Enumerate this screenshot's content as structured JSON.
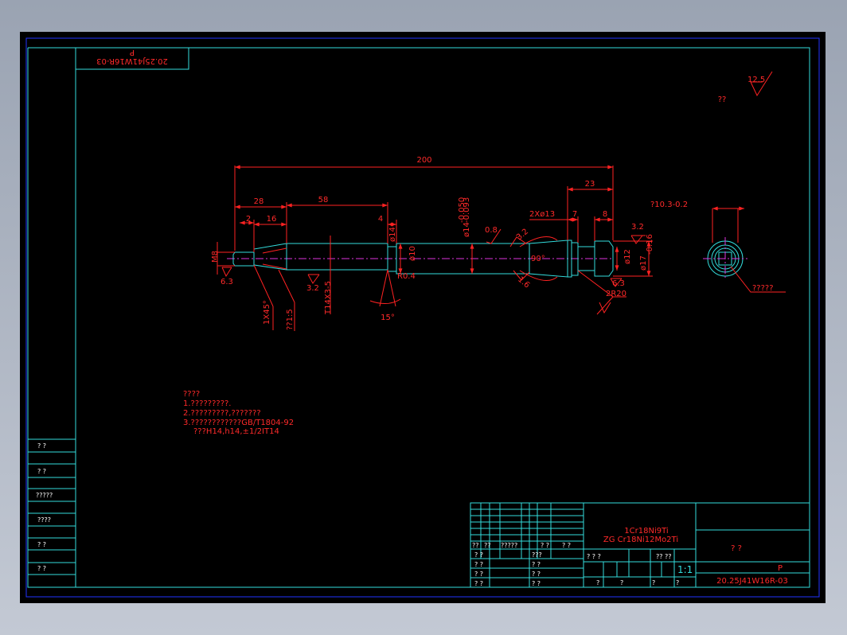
{
  "drawing_number": "20.25J41W16R-03",
  "drawing_number_rotated": "20.25J41W16R-03",
  "rev": "P",
  "rev_rotated": "P",
  "title_unknown": "? ?",
  "scale": "1:1",
  "material_line1": "1Cr18Ni9Ti",
  "material_line2": "ZG Cr18Ni12Mo2Ti",
  "roughness_general": "12.5",
  "roughness_general_label": "??",
  "dims": {
    "overall": "200",
    "d28": "28",
    "d58": "58",
    "d2": "2",
    "d16": "16",
    "d4": "4",
    "d23": "23",
    "d7": "7",
    "d8": "8",
    "hole": "2Xø13",
    "diam10": "ø10",
    "diam14": "ø14",
    "diam14_tol_upper": "-0.050",
    "diam14_tol_lower": "-0.093",
    "diam12": "ø12",
    "diam17": "ø17",
    "diam17_tol": "-0.16",
    "m8": "M8",
    "r04": "R0.4",
    "ang90": "90°",
    "ang15": "15°",
    "chamfer": "1X45°",
    "taper": "??1:5",
    "thread": "T14X3-5",
    "r20": "2R20",
    "ra32a": "3.2",
    "ra32b": "3.2",
    "ra32c": "3.2",
    "ra63a": "6.3",
    "ra63b": "6.3",
    "ra08": "0.8",
    "ra16": "1.6",
    "square": "?10.3-0.2",
    "leader_note": "?????",
    "small_tag": "ø14"
  },
  "notes": {
    "heading": "????",
    "line1": "1.?????????.",
    "line2": "2.?????????,???????",
    "line3": "3.????????????GB/T1804-92",
    "line4": "???H14,h14,±1/2IT14"
  },
  "left_strip": [
    "? ?",
    "? ?",
    "?????",
    "????",
    "? ?",
    "? ?"
  ],
  "title_block": {
    "row_header": [
      "??",
      "??",
      "?????",
      "? ?",
      "? ?"
    ],
    "sign_rows": [
      [
        "? ?",
        "???"
      ],
      [
        "? ?",
        "? ?"
      ],
      [
        "? ?",
        "? ?"
      ],
      [
        "? ?",
        "? ?"
      ]
    ],
    "mid_header": [
      "? ? ?",
      "?? ??"
    ],
    "mid_footer": [
      "?",
      "?",
      "?",
      "?"
    ]
  },
  "colors": {
    "frame": "#33dddd",
    "grid": "#2233ff",
    "annotation": "#ff2222",
    "centerline": "#dd33dd",
    "table_text": "#ffffff"
  }
}
